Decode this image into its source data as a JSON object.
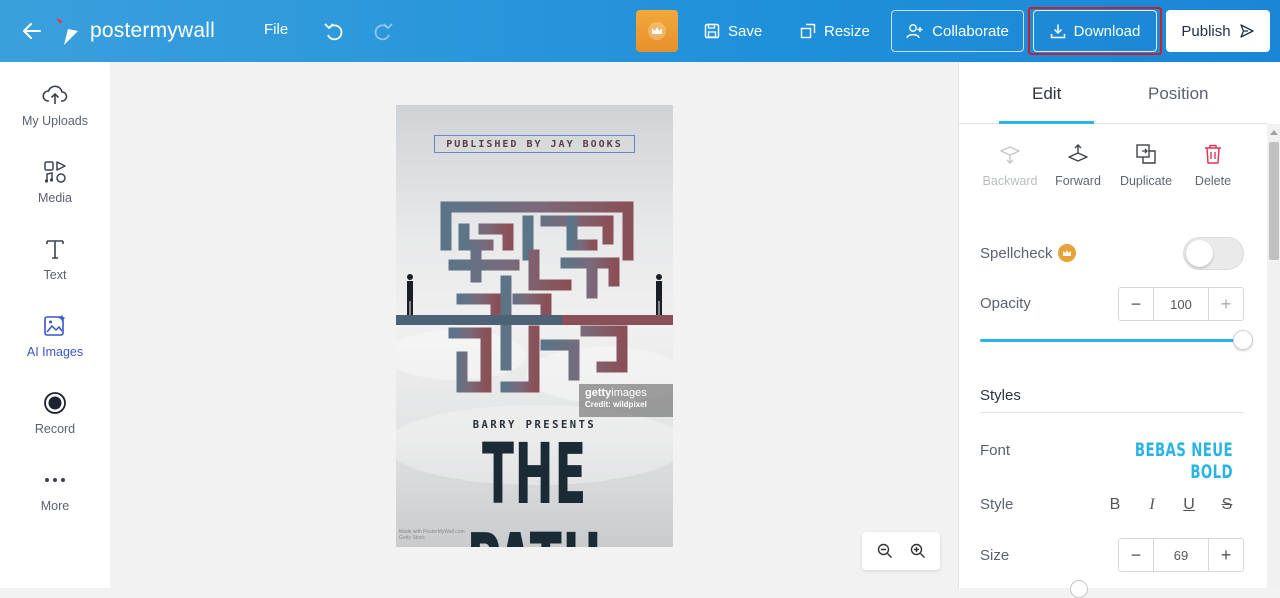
{
  "header": {
    "logo_text": "postermywall",
    "file_label": "File",
    "save_label": "Save",
    "resize_label": "Resize",
    "collaborate_label": "Collaborate",
    "download_label": "Download",
    "publish_label": "Publish",
    "highlight_color": "#c8202f"
  },
  "sidebar": {
    "items": [
      {
        "label": "My Uploads",
        "icon": "upload-cloud-icon"
      },
      {
        "label": "Media",
        "icon": "media-icon"
      },
      {
        "label": "Text",
        "icon": "text-icon"
      },
      {
        "label": "AI Images",
        "icon": "ai-images-icon",
        "active": true
      },
      {
        "label": "Record",
        "icon": "record-icon"
      },
      {
        "label": "More",
        "icon": "more-dots-icon"
      }
    ]
  },
  "poster": {
    "published_by": "PUBLISHED BY JAY BOOKS",
    "getty_brand": "getty",
    "getty_suffix": "images",
    "getty_credit": "Credit: wildpixel",
    "presenter": "BARRY PRESENTS",
    "title": "THE PATH",
    "footer_line1": "Made with PosterMyWall.com",
    "footer_line2": "Getty Stock"
  },
  "panel": {
    "tabs": [
      "Edit",
      "Position"
    ],
    "active_tab": "Edit",
    "tools": [
      "Backward",
      "Forward",
      "Duplicate",
      "Delete"
    ],
    "spellcheck_label": "Spellcheck",
    "spellcheck_on": false,
    "opacity_label": "Opacity",
    "opacity_value": "100",
    "styles_title": "Styles",
    "font_label": "Font",
    "font_value": "BEBAS NEUE BOLD",
    "style_label": "Style",
    "style_buttons": [
      "B",
      "I",
      "U",
      "S"
    ],
    "size_label": "Size",
    "size_value": "69",
    "accent_color": "#2bb3e3"
  }
}
